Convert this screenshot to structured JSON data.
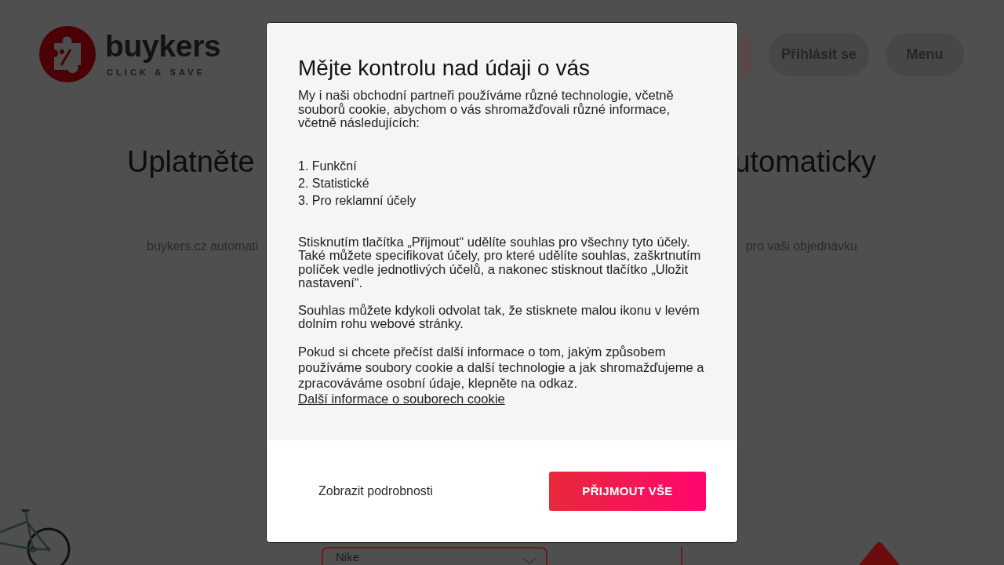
{
  "header": {
    "logo": {
      "wordmark": "buykers",
      "tagline": "CLICK & SAVE"
    },
    "buttons": [
      {
        "label": "Přihlásit se"
      },
      {
        "label": "Menu"
      }
    ]
  },
  "hero": {
    "heading": {
      "left": "Uplatněte",
      "right": "utomaticky"
    },
    "subtitle": {
      "left": "buykers.cz automati",
      "right": "pro vaši objednávku"
    }
  },
  "select_field": {
    "value": "Nike"
  },
  "consent_dialog": {
    "title": "Mějte kontrolu nad údaji o vás",
    "intro": "My i naši obchodní partneři používáme různé technologie, včetně souborů cookie, abychom o vás shromažďovali různé informace, včetně následujících:",
    "purposes": [
      "1. Funkční",
      "2. Statistické",
      "3. Pro reklamní účely"
    ],
    "paragraphs": [
      "Stisknutím tlačítka „Přijmout“ udělíte souhlas pro všechny tyto účely. Také můžete specifikovat účely, pro které udělíte souhlas, zaškrtnutím políček vedle jednotlivých účelů, a nakonec stisknout tlačítko „Uložit nastavení“.",
      "Souhlas můžete kdykoli odvolat tak, že stisknete malou ikonu v levém dolním rohu webové stránky."
    ],
    "more_info": {
      "text": "Pokud si chcete přečíst další informace o tom, jakým způsobem používáme soubory cookie a další technologie a jak shromažďujeme a zpracováváme osobní údaje, klepněte na odkaz.",
      "link": "Další informace o souborech cookie"
    },
    "buttons": [
      {
        "kind": "text",
        "label": "Zobrazit podrobnosti"
      },
      {
        "kind": "primary",
        "label": "PŘIJMOUT VŠE"
      }
    ]
  }
}
